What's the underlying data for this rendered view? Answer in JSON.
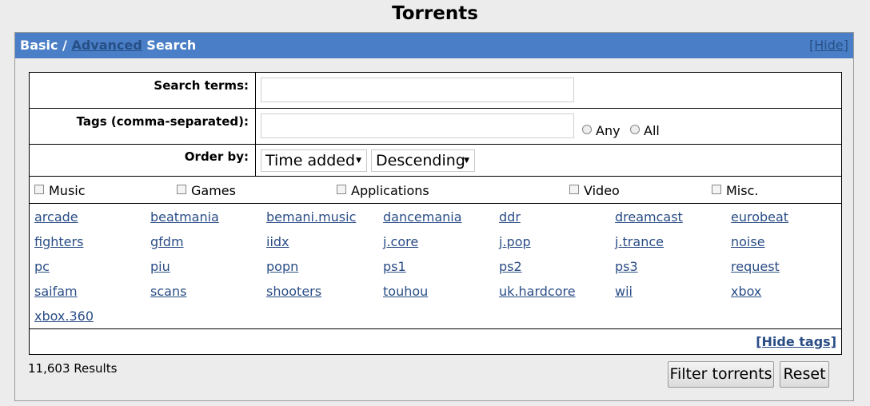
{
  "page": {
    "title": "Torrents"
  },
  "panel": {
    "basic": "Basic",
    "sep": " / ",
    "advanced": "Advanced",
    "search": " Search",
    "hide": "[Hide]"
  },
  "form": {
    "search_label": "Search terms:",
    "search_value": "",
    "tags_label": "Tags (comma-separated):",
    "tags_value": "",
    "radio_any": "Any",
    "radio_all": "All",
    "order_label": "Order by:",
    "order_field": "Time added",
    "order_dir": "Descending"
  },
  "categories": [
    "Music",
    "Games",
    "Applications",
    "Video",
    "Misc."
  ],
  "tags": [
    "arcade",
    "beatmania",
    "bemani.music",
    "dancemania",
    "ddr",
    "dreamcast",
    "eurobeat",
    "fighters",
    "gfdm",
    "iidx",
    "j.core",
    "j.pop",
    "j.trance",
    "noise",
    "pc",
    "piu",
    "popn",
    "ps1",
    "ps2",
    "ps3",
    "request",
    "saifam",
    "scans",
    "shooters",
    "touhou",
    "uk.hardcore",
    "wii",
    "xbox",
    "xbox.360"
  ],
  "hide_tags": "[Hide tags]",
  "results": "11,603 Results",
  "buttons": {
    "filter": "Filter torrents",
    "reset": "Reset"
  }
}
